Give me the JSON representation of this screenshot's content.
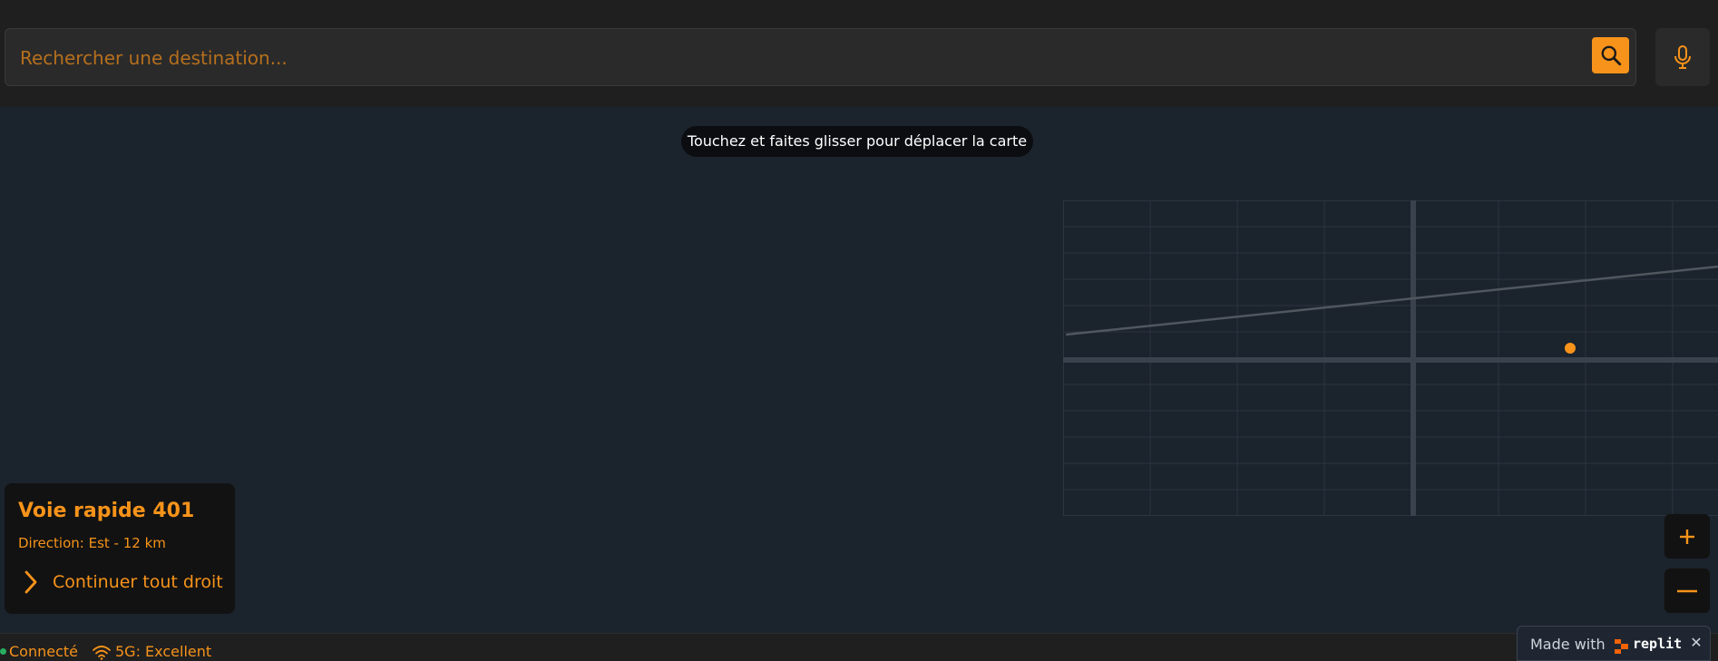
{
  "colors": {
    "accent": "#f7931a",
    "map_background": "#1b232d",
    "bar_background": "#1f1f1f",
    "panel_background": "#121212",
    "status_ok": "#27ae60"
  },
  "search": {
    "placeholder": "Rechercher une destination...",
    "value": "",
    "button_icon": "search-icon",
    "voice_icon": "microphone-icon"
  },
  "map": {
    "hint": "Touchez et faites glisser pour déplacer la carte",
    "location_marker_icon": "location-dot-icon"
  },
  "navigation": {
    "road": "Voie rapide 401",
    "direction": "Direction: Est - 12 km",
    "instruction": "Continuer tout droit",
    "instruction_icon": "chevron-right-icon"
  },
  "zoom": {
    "in_label": "+",
    "out_label": "—"
  },
  "status": {
    "connection": "Connecté",
    "network": "5G: Excellent",
    "network_icon": "wifi-icon"
  },
  "badge": {
    "made_with": "Made with",
    "brand": "replit",
    "close": "✕"
  }
}
